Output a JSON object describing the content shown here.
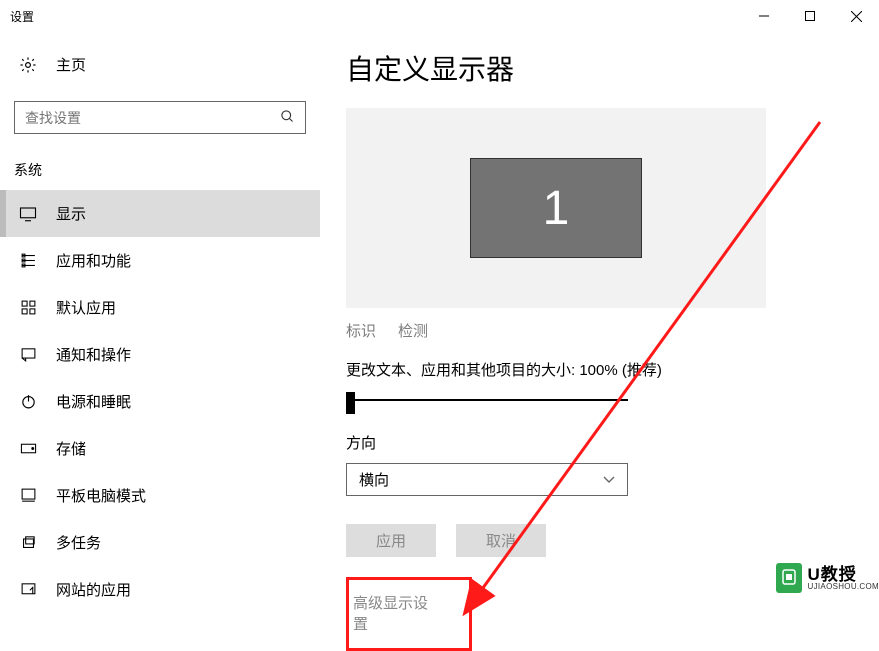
{
  "window": {
    "title": "设置"
  },
  "sidebar": {
    "home_label": "主页",
    "search_placeholder": "查找设置",
    "section_label": "系统",
    "items": [
      {
        "label": "显示",
        "icon": "monitor"
      },
      {
        "label": "应用和功能",
        "icon": "apps"
      },
      {
        "label": "默认应用",
        "icon": "defaults"
      },
      {
        "label": "通知和操作",
        "icon": "notification"
      },
      {
        "label": "电源和睡眠",
        "icon": "power"
      },
      {
        "label": "存储",
        "icon": "storage"
      },
      {
        "label": "平板电脑模式",
        "icon": "tablet"
      },
      {
        "label": "多任务",
        "icon": "multitask"
      },
      {
        "label": "网站的应用",
        "icon": "web-apps"
      }
    ]
  },
  "content": {
    "heading": "自定义显示器",
    "monitor_number": "1",
    "identify": "标识",
    "detect": "检测",
    "scale_label": "更改文本、应用和其他项目的大小: 100% (推荐)",
    "orientation_label": "方向",
    "orientation_value": "横向",
    "apply_btn": "应用",
    "cancel_btn": "取消",
    "advanced_link": "高级显示设置"
  },
  "watermark": {
    "brand": "U教授",
    "url": "UJIAOSHOU.COM"
  }
}
